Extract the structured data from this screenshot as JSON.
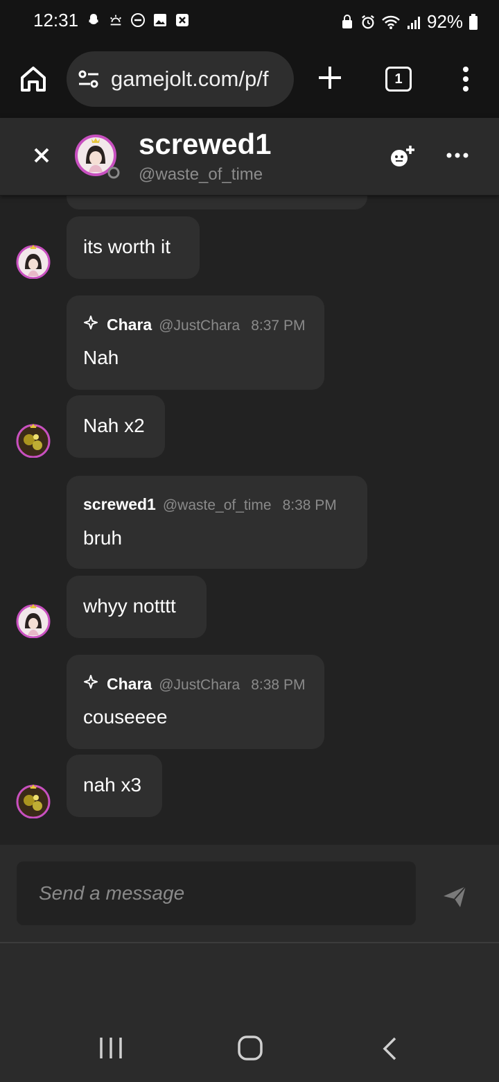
{
  "status_bar": {
    "time": "12:31",
    "battery": "92%",
    "left_icons": [
      "snapchat-icon",
      "weather-icon",
      "dnd-icon",
      "gallery-icon",
      "close-box-icon"
    ],
    "right_icons": [
      "vpn-icon",
      "alarm-icon",
      "wifi-icon",
      "signal-icon",
      "battery-icon"
    ]
  },
  "browser": {
    "url": "gamejolt.com/p/f",
    "tab_count": "1"
  },
  "chat_header": {
    "name": "screwed1",
    "handle": "@waste_of_time"
  },
  "messages": [
    {
      "type": "bubble",
      "text": "its worth it",
      "avatar": "screwed1-avatar"
    },
    {
      "type": "card",
      "author": "Chara",
      "handle": "@JustChara",
      "time": "8:37 PM",
      "text": "Nah",
      "sparkle": true
    },
    {
      "type": "bubble",
      "text": "Nah x2",
      "avatar": "chara-avatar"
    },
    {
      "type": "card",
      "author": "screwed1",
      "handle": "@waste_of_time",
      "time": "8:38 PM",
      "text": "bruh",
      "sparkle": false
    },
    {
      "type": "bubble",
      "text": "whyy notttt",
      "avatar": "screwed1-avatar"
    },
    {
      "type": "card",
      "author": "Chara",
      "handle": "@JustChara",
      "time": "8:38 PM",
      "text": "couseeee",
      "sparkle": true
    },
    {
      "type": "bubble",
      "text": "nah x3",
      "avatar": "chara-avatar"
    }
  ],
  "composer": {
    "placeholder": "Send a message"
  },
  "colors": {
    "accent_ring": "#c850c0",
    "bubble_bg": "#2f2f2f",
    "chat_bg": "#222222"
  }
}
